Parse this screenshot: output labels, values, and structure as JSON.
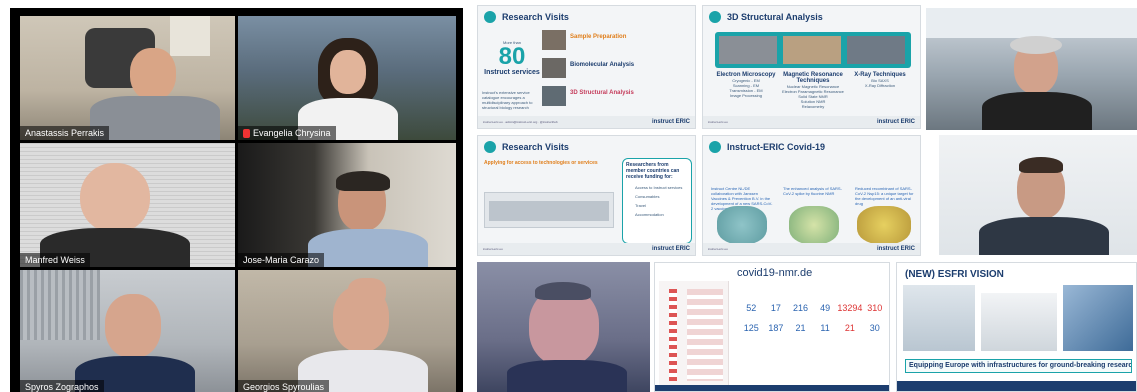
{
  "participants": [
    {
      "name": "Anastassis Perrakis",
      "active": true
    },
    {
      "name": "Evangelia Chrysina",
      "muted": true
    },
    {
      "name": "Manfred Weiss"
    },
    {
      "name": "Jose-Maria Carazo"
    },
    {
      "name": "Spyros Zographos"
    },
    {
      "name": "Georgios Spyroulias"
    }
  ],
  "slide1": {
    "title": "Research Visits",
    "big_prefix": "More than",
    "big_number": "80",
    "big_suffix": "Instruct services",
    "body": "Instruct's extensive service catalogue encourages a multidisciplinary approach to structural biology research",
    "rows": [
      "Sample Preparation",
      "Biomolecular Analysis",
      "3D Structural Analysis"
    ],
    "footer_url": "instruct-eric.eu",
    "footer_email": "admin@instruct-eric.org",
    "footer_handle": "@instructhub",
    "logo": "instruct ERIC"
  },
  "slide2": {
    "title": "3D Structural Analysis",
    "columns": [
      "Electron Microscopy",
      "Magnetic Resonance Techniques",
      "X-Ray Techniques"
    ],
    "col_items": [
      [
        "Cryogenic - EM",
        "Scanning - EM",
        "Transmission - EM",
        "Image Processing"
      ],
      [
        "Nuclear Magnetic Resonance",
        "Electron Paramagnetic Resonance",
        "Solid State NMR",
        "Solution NMR",
        "Relaxometry"
      ],
      [
        "Bio SAXS",
        "X-Ray Diffraction"
      ]
    ]
  },
  "slide3": {
    "title": "Research Visits",
    "subtitle": "Applying for access to technologies or services",
    "box_title": "Researchers from member countries can receive funding for:",
    "box_items": [
      "Access to Instruct services",
      "Consumables",
      "Travel",
      "Accommodation"
    ]
  },
  "slide4": {
    "title": "Instruct-ERIC Covid-19",
    "links": [
      "Instruct Centre NL/DE collaboration with Janssen Vaccines & Prevention B.V. in the development of a new SARS-CoV-2 vaccine",
      "The enhanced analysis of SARS-CoV-2 spike by fluorine NMR",
      "Reduced recombinant of SARS-CoV-2 Nsp15: a unique target for the development of an anti-viral drug"
    ]
  },
  "covid_nmr": {
    "title": "covid19-nmr.de",
    "row1": [
      52,
      17,
      216,
      49,
      13294,
      310
    ],
    "row2": [
      125,
      187,
      21,
      11,
      21,
      30
    ]
  },
  "esfri": {
    "title": "(NEW) ESFRI VISION",
    "banner": "Equipping Europe with infrastructures for ground-breaking research"
  }
}
